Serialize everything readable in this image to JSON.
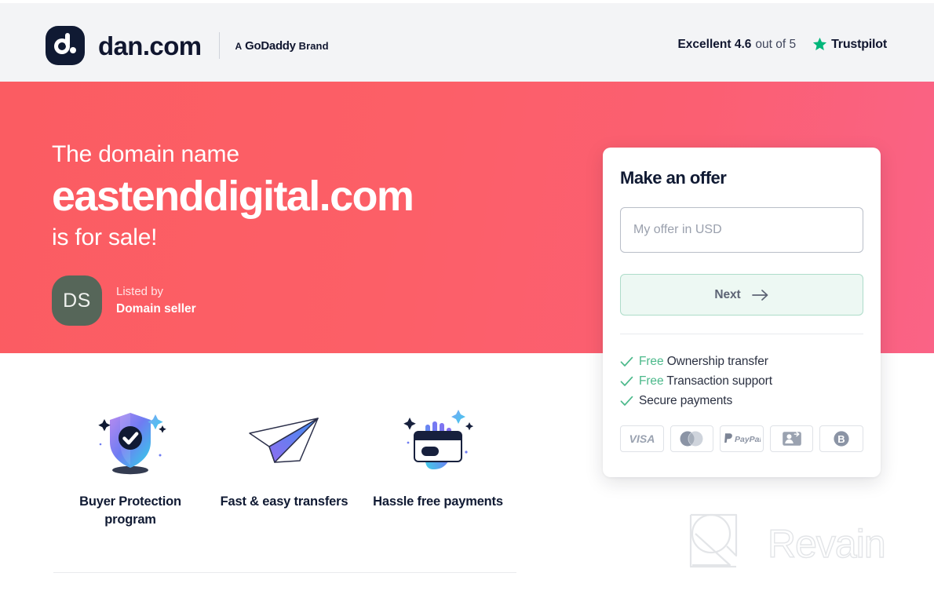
{
  "header": {
    "logo_text": "dan.com",
    "logo_icon": "dan-logo-icon",
    "brand_a": "A",
    "brand_godaddy": "GoDaddy",
    "brand_brand": "Brand",
    "trustpilot": {
      "rating_text": "Excellent 4.6",
      "out_of_text": "out of 5",
      "name": "Trustpilot",
      "star_icon": "trustpilot-star-icon",
      "star_color": "#00b67a",
      "rating_value": "4.6",
      "rating_max": "5",
      "rating_word": "Excellent"
    }
  },
  "hero": {
    "pre_text": "The domain name",
    "domain": "eastenddigital.com",
    "post_text": "is for sale!",
    "gradient_from": "#fb5c62",
    "gradient_to": "#fa6386",
    "seller": {
      "initials": "DS",
      "listed_by_label": "Listed by",
      "name": "Domain seller",
      "avatar_color": "#566659"
    }
  },
  "offer_card": {
    "title": "Make an offer",
    "input_placeholder": "My offer in USD",
    "input_value": "",
    "next_label": "Next",
    "next_arrow_icon": "arrow-right-icon",
    "next_bg": "#edf8f3",
    "next_border": "#aedcc9",
    "benefits": [
      {
        "free": "Free",
        "text": "Ownership transfer",
        "check_icon": "check-icon"
      },
      {
        "free": "Free",
        "text": "Transaction support",
        "check_icon": "check-icon"
      },
      {
        "free": "",
        "text": "Secure payments",
        "check_icon": "check-icon"
      }
    ],
    "payment_methods": [
      {
        "name": "VISA",
        "icon": "visa-icon"
      },
      {
        "name": "Mastercard",
        "icon": "mastercard-icon"
      },
      {
        "name": "PayPal",
        "icon": "paypal-icon"
      },
      {
        "name": "Bank transfer",
        "icon": "bank-transfer-icon"
      },
      {
        "name": "Bitcoin",
        "icon": "bitcoin-icon"
      }
    ]
  },
  "features": [
    {
      "title": "Buyer Protection program",
      "icon": "shield-check-icon"
    },
    {
      "title": "Fast & easy transfers",
      "icon": "paper-plane-icon"
    },
    {
      "title": "Hassle free payments",
      "icon": "hand-credit-card-icon"
    }
  ],
  "watermark": {
    "text": "Revain",
    "icon": "revain-logo-icon",
    "color": "#e3e5e8"
  }
}
